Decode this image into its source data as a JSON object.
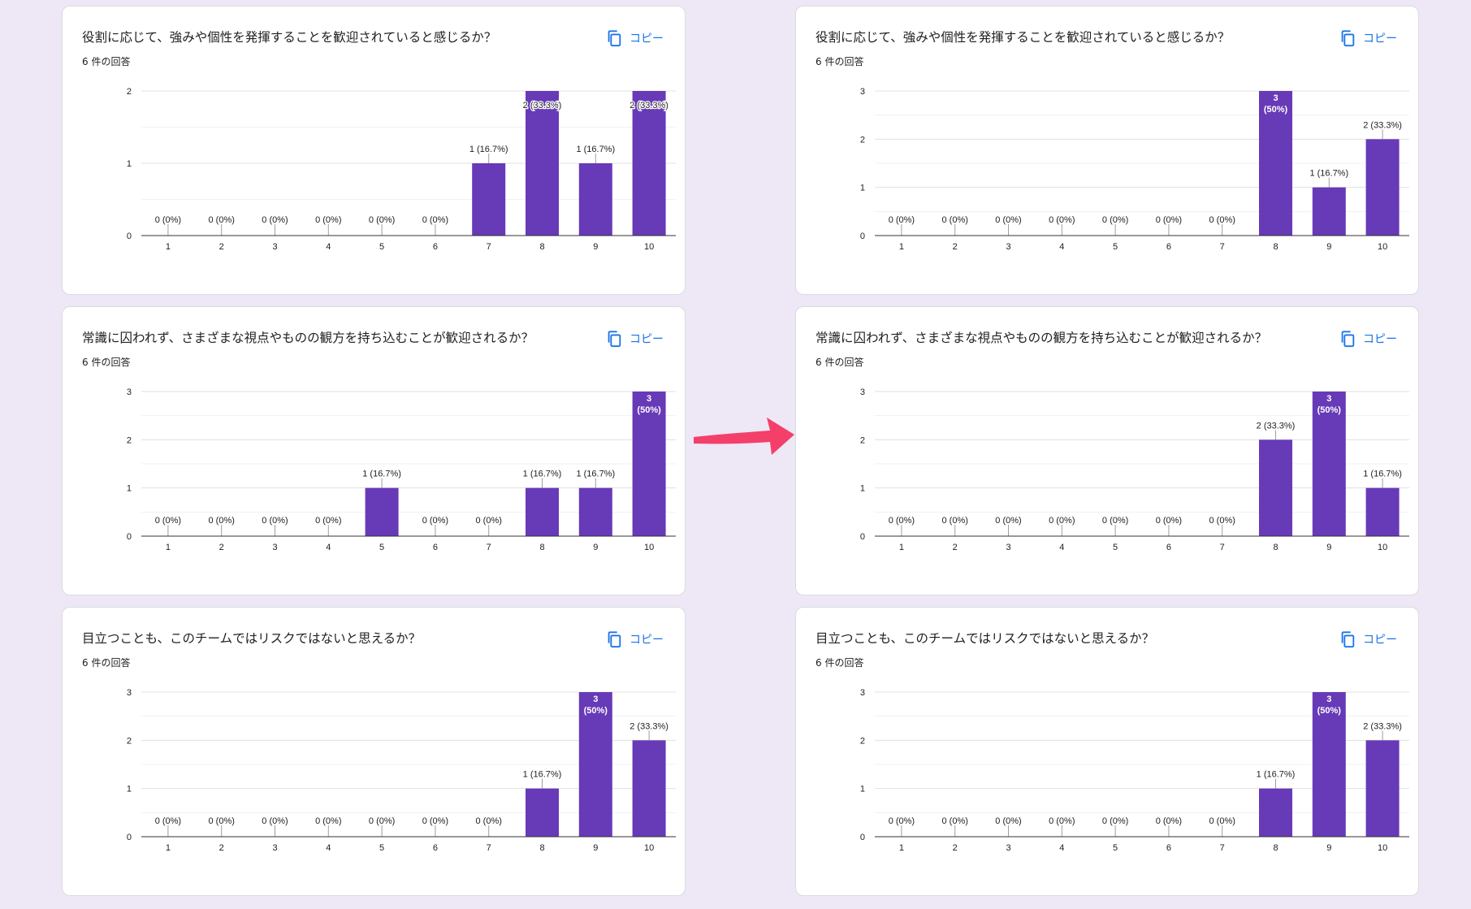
{
  "theme": {
    "bar_color": "#673ab7",
    "link_color": "#1a73e8",
    "arrow_color": "#f43f6b",
    "background": "#ede7f6"
  },
  "cards": [
    {
      "title": "役割に応じて、強みや個性を発揮することを歓迎されていると感じるか？",
      "response_count": "6 件の回答",
      "copy_label": "コピー",
      "copy_icon": "copy-icon",
      "chart_data": {
        "type": "bar",
        "categories": [
          "1",
          "2",
          "3",
          "4",
          "5",
          "6",
          "7",
          "8",
          "9",
          "10"
        ],
        "values": [
          0,
          0,
          0,
          0,
          0,
          0,
          1,
          2,
          1,
          2
        ],
        "labels": [
          "0 (0%)",
          "0 (0%)",
          "0 (0%)",
          "0 (0%)",
          "0 (0%)",
          "0 (0%)",
          "1 (16.7%)",
          "2 (33.3%)",
          "1 (16.7%)",
          "2 (33.3%)"
        ],
        "yticks": [
          0,
          1,
          2
        ],
        "ylim": [
          0,
          2
        ]
      }
    },
    {
      "title": "役割に応じて、強みや個性を発揮することを歓迎されていると感じるか？",
      "response_count": "6 件の回答",
      "copy_label": "コピー",
      "copy_icon": "copy-icon",
      "chart_data": {
        "type": "bar",
        "categories": [
          "1",
          "2",
          "3",
          "4",
          "5",
          "6",
          "7",
          "8",
          "9",
          "10"
        ],
        "values": [
          0,
          0,
          0,
          0,
          0,
          0,
          0,
          3,
          1,
          2
        ],
        "labels": [
          "0 (0%)",
          "0 (0%)",
          "0 (0%)",
          "0 (0%)",
          "0 (0%)",
          "0 (0%)",
          "0 (0%)",
          "3\n(50%)",
          "1 (16.7%)",
          "2 (33.3%)"
        ],
        "yticks": [
          0,
          1,
          2,
          3
        ],
        "ylim": [
          0,
          3
        ]
      }
    },
    {
      "title": "常識に囚われず、さまざまな視点やものの観方を持ち込むことが歓迎されるか？",
      "response_count": "6 件の回答",
      "copy_label": "コピー",
      "copy_icon": "copy-icon",
      "chart_data": {
        "type": "bar",
        "categories": [
          "1",
          "2",
          "3",
          "4",
          "5",
          "6",
          "7",
          "8",
          "9",
          "10"
        ],
        "values": [
          0,
          0,
          0,
          0,
          1,
          0,
          0,
          1,
          1,
          3
        ],
        "labels": [
          "0 (0%)",
          "0 (0%)",
          "0 (0%)",
          "0 (0%)",
          "1 (16.7%)",
          "0 (0%)",
          "0 (0%)",
          "1 (16.7%)",
          "1 (16.7%)",
          "3\n(50%)"
        ],
        "yticks": [
          0,
          1,
          2,
          3
        ],
        "ylim": [
          0,
          3
        ]
      }
    },
    {
      "title": "常識に囚われず、さまざまな視点やものの観方を持ち込むことが歓迎されるか？",
      "response_count": "6 件の回答",
      "copy_label": "コピー",
      "copy_icon": "copy-icon",
      "chart_data": {
        "type": "bar",
        "categories": [
          "1",
          "2",
          "3",
          "4",
          "5",
          "6",
          "7",
          "8",
          "9",
          "10"
        ],
        "values": [
          0,
          0,
          0,
          0,
          0,
          0,
          0,
          2,
          3,
          1
        ],
        "labels": [
          "0 (0%)",
          "0 (0%)",
          "0 (0%)",
          "0 (0%)",
          "0 (0%)",
          "0 (0%)",
          "0 (0%)",
          "2 (33.3%)",
          "3\n(50%)",
          "1 (16.7%)"
        ],
        "yticks": [
          0,
          1,
          2,
          3
        ],
        "ylim": [
          0,
          3
        ]
      }
    },
    {
      "title": "目立つことも、このチームではリスクではないと思えるか？",
      "response_count": "6 件の回答",
      "copy_label": "コピー",
      "copy_icon": "copy-icon",
      "chart_data": {
        "type": "bar",
        "categories": [
          "1",
          "2",
          "3",
          "4",
          "5",
          "6",
          "7",
          "8",
          "9",
          "10"
        ],
        "values": [
          0,
          0,
          0,
          0,
          0,
          0,
          0,
          1,
          3,
          2
        ],
        "labels": [
          "0 (0%)",
          "0 (0%)",
          "0 (0%)",
          "0 (0%)",
          "0 (0%)",
          "0 (0%)",
          "0 (0%)",
          "1 (16.7%)",
          "3\n(50%)",
          "2 (33.3%)"
        ],
        "yticks": [
          0,
          1,
          2,
          3
        ],
        "ylim": [
          0,
          3
        ]
      }
    },
    {
      "title": "目立つことも、このチームではリスクではないと思えるか？",
      "response_count": "6 件の回答",
      "copy_label": "コピー",
      "copy_icon": "copy-icon",
      "chart_data": {
        "type": "bar",
        "categories": [
          "1",
          "2",
          "3",
          "4",
          "5",
          "6",
          "7",
          "8",
          "9",
          "10"
        ],
        "values": [
          0,
          0,
          0,
          0,
          0,
          0,
          0,
          1,
          3,
          2
        ],
        "labels": [
          "0 (0%)",
          "0 (0%)",
          "0 (0%)",
          "0 (0%)",
          "0 (0%)",
          "0 (0%)",
          "0 (0%)",
          "1 (16.7%)",
          "3\n(50%)",
          "2 (33.3%)"
        ],
        "yticks": [
          0,
          1,
          2,
          3
        ],
        "ylim": [
          0,
          3
        ]
      }
    }
  ],
  "arrow_icon": "arrow-right-icon"
}
